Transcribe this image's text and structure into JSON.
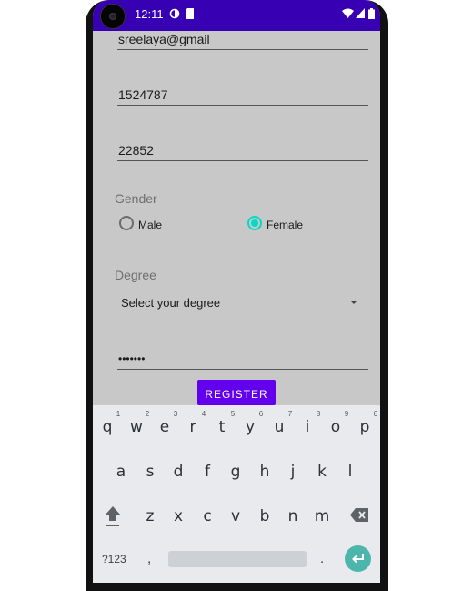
{
  "status_bar": {
    "time": "12:11"
  },
  "form": {
    "email_value": "sreelaya@gmail",
    "phone_value": "1524787",
    "pin_value": "22852",
    "gender_label": "Gender",
    "gender_options": [
      {
        "label": "Male",
        "checked": false
      },
      {
        "label": "Female",
        "checked": true
      }
    ],
    "degree_label": "Degree",
    "degree_selected": "Select your degree",
    "password_value": "•••••••",
    "register_label": "REGISTER"
  },
  "keyboard": {
    "row1": [
      "q",
      "w",
      "e",
      "r",
      "t",
      "y",
      "u",
      "i",
      "o",
      "p"
    ],
    "row1_hints": [
      "1",
      "2",
      "3",
      "4",
      "5",
      "6",
      "7",
      "8",
      "9",
      "0"
    ],
    "row2": [
      "a",
      "s",
      "d",
      "f",
      "g",
      "h",
      "j",
      "k",
      "l"
    ],
    "row3": [
      "z",
      "x",
      "c",
      "v",
      "b",
      "n",
      "m"
    ],
    "symbols_label": "?123",
    "comma": ",",
    "period": ".",
    "icons": [
      "shift-icon",
      "backspace-icon",
      "enter-icon"
    ],
    "accent_color": "#4db6ac"
  },
  "colors": {
    "status_bar": "#3700b3",
    "button": "#6200ee",
    "radio_accent": "#03dac5"
  }
}
